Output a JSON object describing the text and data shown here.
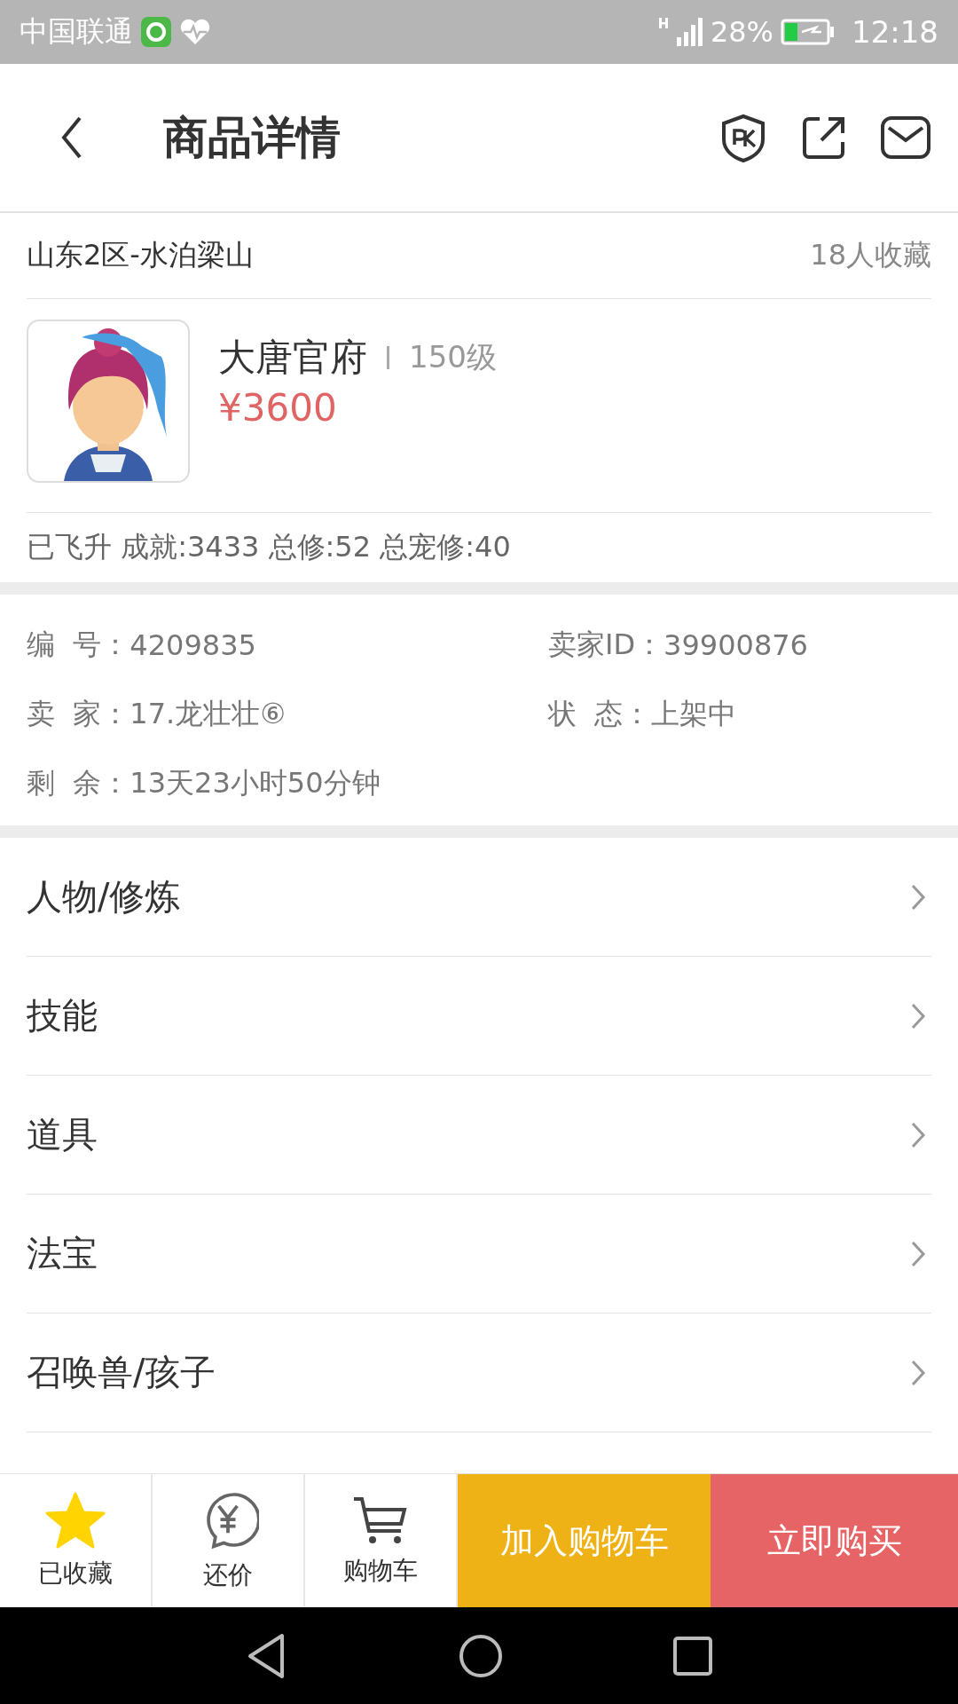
{
  "status_bar": {
    "carrier": "中国联通",
    "battery": "28%",
    "time": "12:18"
  },
  "header": {
    "title": "商品详情"
  },
  "listing": {
    "region": "山东2区-水泊梁山",
    "favorites": "18人收藏"
  },
  "product": {
    "school": "大唐官府",
    "level": "150级",
    "price": "¥3600",
    "stats": "已飞升 成就:3433 总修:52 总宠修:40"
  },
  "info": [
    {
      "label": "编  号：",
      "value": "4209835"
    },
    {
      "label": "卖家ID：",
      "value": "39900876"
    },
    {
      "label": "卖  家：",
      "value": "17.龙壮壮⑥"
    },
    {
      "label": "状  态：",
      "value": "上架中"
    },
    {
      "label": "剩  余：",
      "value": "13天23小时50分钟"
    }
  ],
  "sections": [
    "人物/修炼",
    "技能",
    "道具",
    "法宝",
    "召唤兽/孩子"
  ],
  "bottom_bar": {
    "tabs": [
      {
        "kind": "favorite",
        "label": "已收藏",
        "on": true
      },
      {
        "kind": "bargain",
        "label": "还价"
      },
      {
        "kind": "cart",
        "label": "购物车"
      }
    ],
    "buttons": [
      {
        "kind": "add",
        "label": "加入购物车"
      },
      {
        "kind": "buy",
        "label": "立即购买"
      }
    ]
  }
}
